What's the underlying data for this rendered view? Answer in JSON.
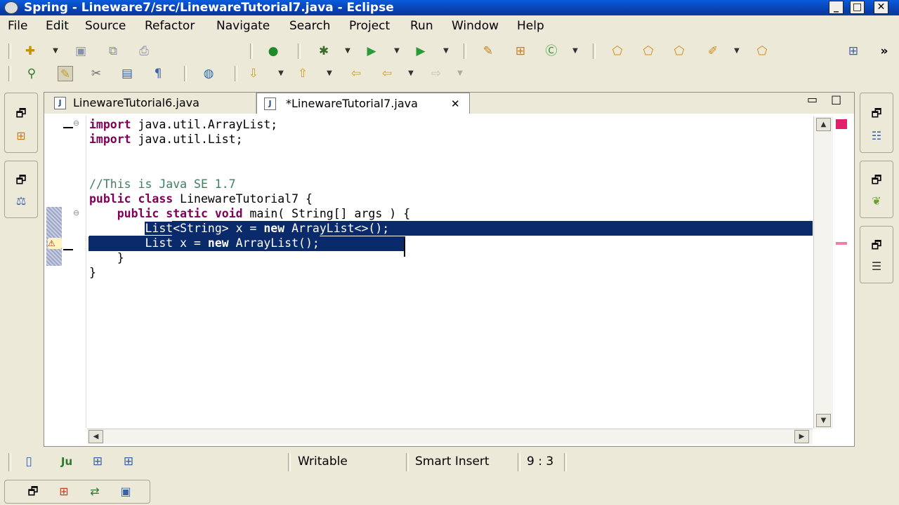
{
  "window": {
    "title": "Spring - Lineware7/src/LinewareTutorial7.java - Eclipse",
    "minimize": "_",
    "maximize": "□",
    "close": "✕"
  },
  "menu": [
    "File",
    "Edit",
    "Source",
    "Refactor",
    "Navigate",
    "Search",
    "Project",
    "Run",
    "Window",
    "Help"
  ],
  "toolbar": {
    "more": "»"
  },
  "editor": {
    "tabs": [
      {
        "label": "LinewareTutorial6.java",
        "active": false
      },
      {
        "label": "*LinewareTutorial7.java",
        "active": true,
        "close": "✕"
      }
    ],
    "code_lines": [
      {
        "kw": "import",
        "rest": " java.util.ArrayList;"
      },
      {
        "kw": "import",
        "rest": " java.util.List;"
      },
      {
        "comment": "//This is Java SE 1.7"
      },
      {
        "kw1": "public",
        "kw2": "class",
        "rest": " LinewareTutorial7 {"
      },
      {
        "indent": "    ",
        "kw1": "public",
        "kw2": "static",
        "kw3": "void",
        "rest": " main( String[] args ) {"
      },
      {
        "indent": "        ",
        "text": "List<String> x = ",
        "kw": "new",
        "rest": " ArrayList<>();"
      },
      {
        "indent": "        ",
        "text": "List x = ",
        "kw": "new",
        "rest": " ArrayList();"
      },
      {
        "text": "    }"
      },
      {
        "text": "}"
      }
    ]
  },
  "status": {
    "writable": "Writable",
    "insert_mode": "Smart Insert",
    "cursor_position": "9 : 3"
  },
  "colors": {
    "keyword": "#7f0055",
    "comment": "#3f7f5f",
    "selection": "#0b2a6b",
    "titlebar": "#0842b0"
  }
}
